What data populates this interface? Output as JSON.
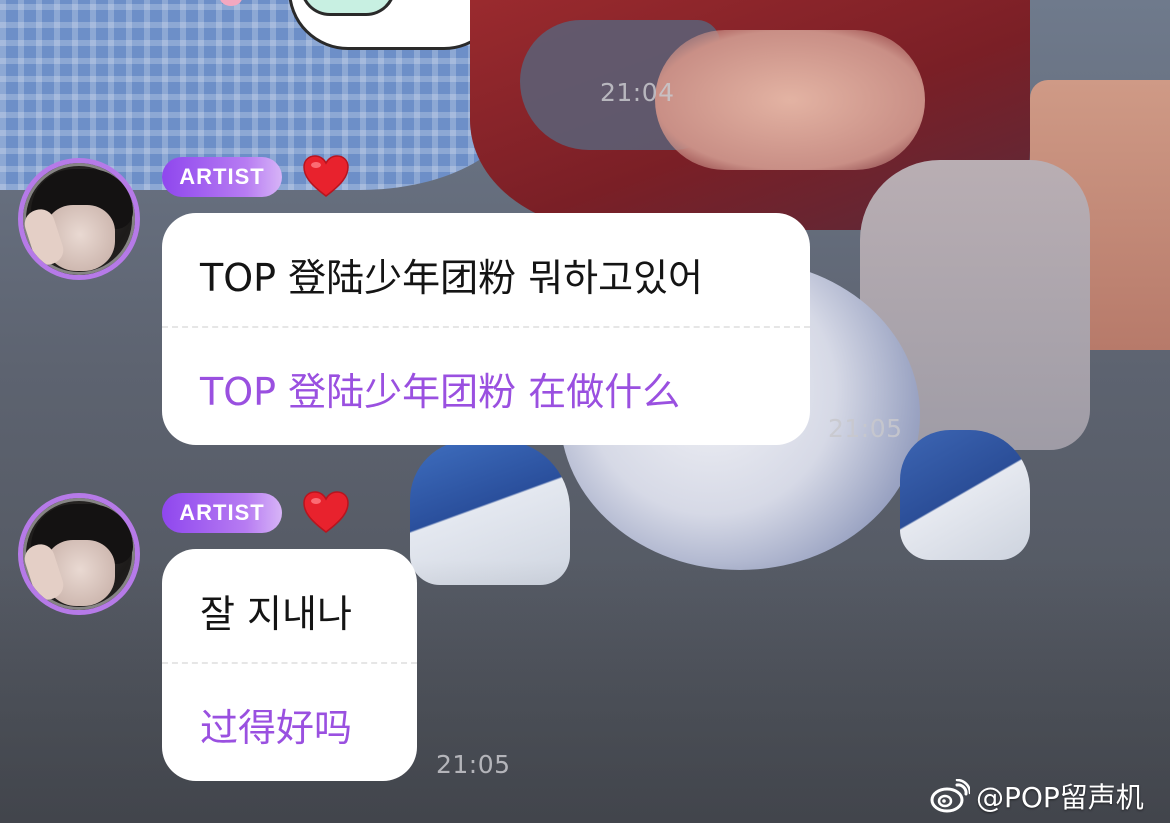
{
  "timestamps": {
    "top": "21:04",
    "first_message": "21:05",
    "second_message": "21:05"
  },
  "messages": [
    {
      "badge": "ARTIST",
      "original": "TOP 登陆少年团粉 뭐하고있어",
      "translation": "TOP 登陆少年团粉 在做什么"
    },
    {
      "badge": "ARTIST",
      "original": "잘 지내나",
      "translation": "过得好吗"
    }
  ],
  "watermark": {
    "text": "@POP留声机",
    "icon": "weibo-icon"
  },
  "colors": {
    "accent": "#9a50e0",
    "badge_start": "#8f47ee",
    "badge_end": "#d7b4f7",
    "heart": "#e8222d",
    "bubble": "#ffffff",
    "avatar_ring": "#b67ae8"
  },
  "icons": {
    "heart": "heart-icon",
    "avatar": "avatar"
  }
}
